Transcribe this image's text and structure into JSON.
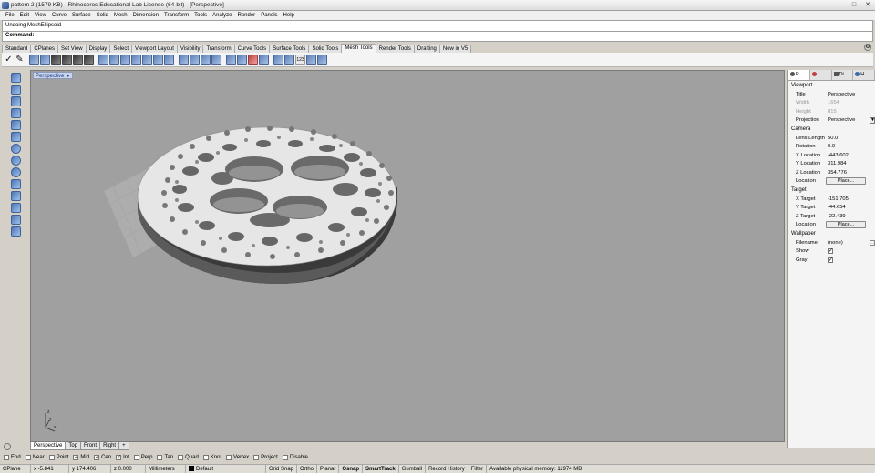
{
  "window": {
    "title": "pattern 2 (1579 KB) - Rhinoceros Educational Lab License (64-bit) - [Perspective]"
  },
  "menu": [
    "File",
    "Edit",
    "View",
    "Curve",
    "Surface",
    "Solid",
    "Mesh",
    "Dimension",
    "Transform",
    "Tools",
    "Analyze",
    "Render",
    "Panels",
    "Help"
  ],
  "command": {
    "history": "Undoing MeshEllipsoid",
    "prompt": "Command:"
  },
  "tabs": [
    "Standard",
    "CPlanes",
    "Set View",
    "Display",
    "Select",
    "Viewport Layout",
    "Visibility",
    "Transform",
    "Curve Tools",
    "Surface Tools",
    "Solid Tools",
    "Mesh Tools",
    "Render Tools",
    "Drafting",
    "New in V5"
  ],
  "active_tab": "Mesh Tools",
  "toolbar_number_label": "123",
  "viewport": {
    "label": "Perspective",
    "axis_x": "x",
    "axis_y": "y",
    "axis_z": "z"
  },
  "viewport_tabs": [
    "Perspective",
    "Top",
    "Front",
    "Right"
  ],
  "viewport_tab_add": "+",
  "osnaps": [
    {
      "label": "End",
      "checked": false
    },
    {
      "label": "Near",
      "checked": false
    },
    {
      "label": "Point",
      "checked": false
    },
    {
      "label": "Mid",
      "checked": true
    },
    {
      "label": "Cen",
      "checked": true
    },
    {
      "label": "Int",
      "checked": true
    },
    {
      "label": "Perp",
      "checked": false
    },
    {
      "label": "Tan",
      "checked": false
    },
    {
      "label": "Quad",
      "checked": false
    },
    {
      "label": "Knot",
      "checked": false
    },
    {
      "label": "Vertex",
      "checked": false
    },
    {
      "label": "Project",
      "checked": false
    },
    {
      "label": "Disable",
      "checked": false
    }
  ],
  "status": {
    "cplane": "CPlane",
    "x": "x -5.841",
    "y": "y 174.406",
    "z": "z 0.000",
    "units": "Millimeters",
    "layer": "Default",
    "grid_snap": "Grid Snap",
    "ortho": "Ortho",
    "planar": "Planar",
    "osnap": "Osnap",
    "smarttrack": "SmartTrack",
    "gumball": "Gumball",
    "record_history": "Record History",
    "filter": "Filter",
    "memory": "Available physical memory: 11974 MB"
  },
  "panel": {
    "tabs": [
      "P...",
      "L...",
      "Di...",
      "H..."
    ],
    "viewport_header": "Viewport",
    "title_key": "Title",
    "title_val": "Perspective",
    "width_key": "Width",
    "width_val": "1654",
    "height_key": "Height",
    "height_val": "815",
    "projection_key": "Projection",
    "projection_val": "Perspective",
    "camera_header": "Camera",
    "lens_key": "Lens Length",
    "lens_val": "50.0",
    "rotation_key": "Rotation",
    "rotation_val": "0.0",
    "xloc_key": "X Location",
    "xloc_val": "-443.602",
    "yloc_key": "Y Location",
    "yloc_val": "311.984",
    "zloc_key": "Z Location",
    "zloc_val": "354.776",
    "location_key": "Location",
    "place_label": "Place...",
    "target_header": "Target",
    "xt_key": "X Target",
    "xt_val": "-151.705",
    "yt_key": "Y Target",
    "yt_val": "-44.654",
    "zt_key": "Z Target",
    "zt_val": "-22.439",
    "tlocation_key": "Location",
    "tplace_label": "Place...",
    "wallpaper_header": "Wallpaper",
    "filename_key": "Filename",
    "filename_val": "(none)",
    "show_key": "Show",
    "gray_key": "Gray"
  }
}
